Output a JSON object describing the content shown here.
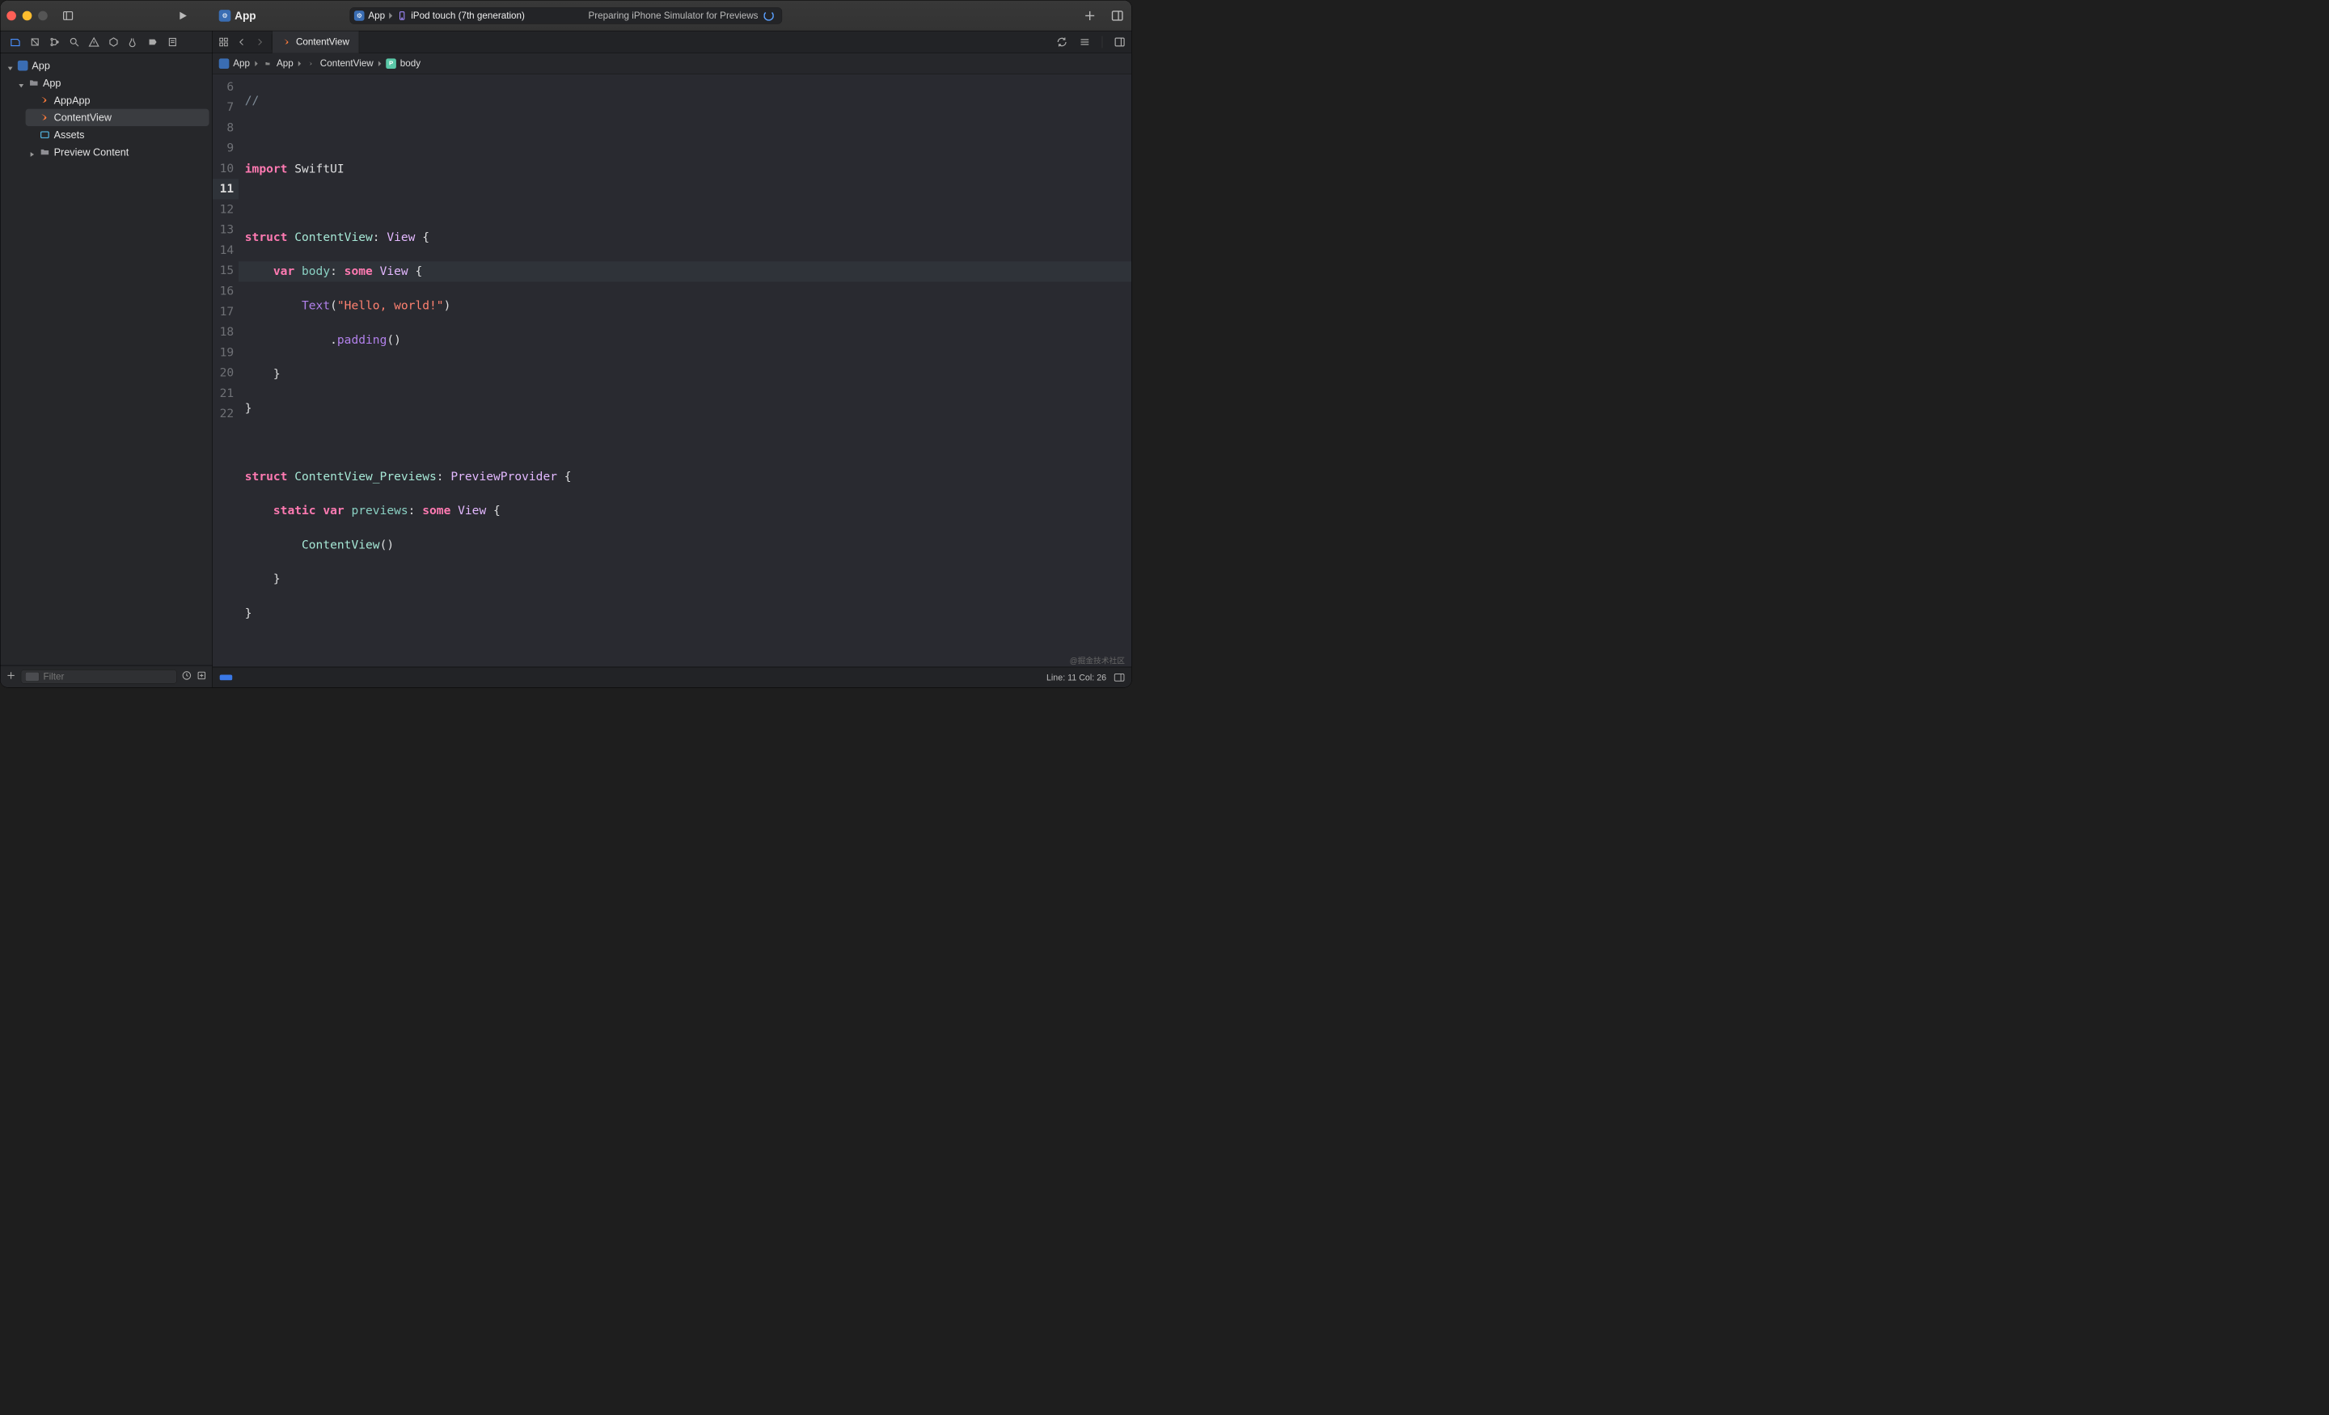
{
  "toolbar": {
    "app_name": "App",
    "scheme_app": "App",
    "scheme_device": "iPod touch (7th generation)",
    "status_text": "Preparing iPhone Simulator for Previews"
  },
  "sidebar": {
    "tree": {
      "project": "App",
      "group": "App",
      "file_appapp": "AppApp",
      "file_contentview": "ContentView",
      "assets": "Assets",
      "preview_content": "Preview Content"
    },
    "filter_placeholder": "Filter"
  },
  "tabs": {
    "file_name": "ContentView"
  },
  "breadcrumb": {
    "c1": "App",
    "c2": "App",
    "c3": "ContentView",
    "c4": "body"
  },
  "code": {
    "line_numbers": [
      "6",
      "7",
      "8",
      "9",
      "10",
      "11",
      "12",
      "13",
      "14",
      "15",
      "16",
      "17",
      "18",
      "19",
      "20",
      "21",
      "22"
    ],
    "l6_comment": "//",
    "l8_import": "import",
    "l8_module": " SwiftUI",
    "l10_struct": "struct",
    "l10_name": " ContentView",
    "l10_colon": ": ",
    "l10_proto": "View",
    "l10_brace": " {",
    "l11_var": "var",
    "l11_body": " body",
    "l11_colon": ": ",
    "l11_some": "some",
    "l11_view": " View",
    "l11_brace": " {",
    "l12_text": "Text",
    "l12_paren_open": "(",
    "l12_str": "\"Hello, world!\"",
    "l12_paren_close": ")",
    "l13_dot": ".",
    "l13_padding": "padding",
    "l13_parens": "()",
    "l14_brace": "}",
    "l15_brace": "}",
    "l17_struct": "struct",
    "l17_name": " ContentView_Previews",
    "l17_colon": ": ",
    "l17_proto": "PreviewProvider",
    "l17_brace": " {",
    "l18_static": "static",
    "l18_var": " var",
    "l18_prev": " previews",
    "l18_colon": ": ",
    "l18_some": "some",
    "l18_view": " View",
    "l18_brace": " {",
    "l19_cv": "ContentView",
    "l19_parens": "()",
    "l20_brace": "}",
    "l21_brace": "}"
  },
  "statusbar": {
    "line_col": "Line: 11  Col: 26"
  },
  "watermark": "@掘金技术社区"
}
